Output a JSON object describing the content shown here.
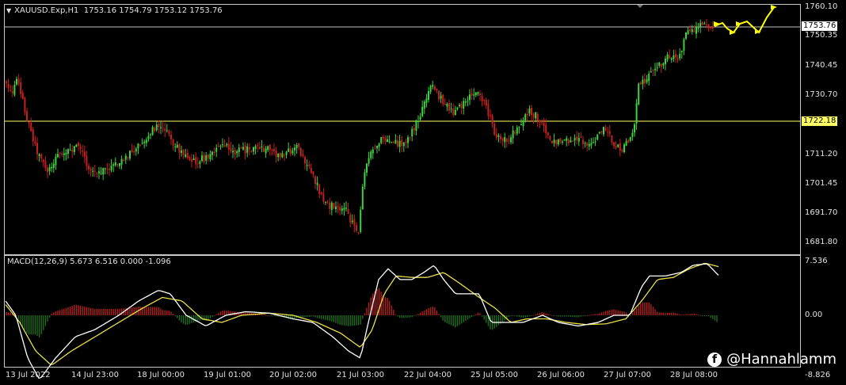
{
  "main_panel": {
    "symbol_label": "XAUUSD.Exp,H1",
    "ohlc": "1753.16 1754.79 1753.12 1753.76",
    "price_axis": [
      "1760.10",
      "1750.35",
      "1740.45",
      "1730.70",
      "1711.20",
      "1701.45",
      "1691.70",
      "1681.80"
    ],
    "current_price": "1753.76",
    "hline_price": "1722.18"
  },
  "macd_panel": {
    "label": "MACD(12,26,9) 5.673 6.516 0.000 -1.096",
    "axis": [
      "7.536",
      "0.00",
      "-8.826"
    ]
  },
  "time_axis": [
    "13 Jul 2022",
    "14 Jul 23:00",
    "18 Jul 00:00",
    "19 Jul 01:00",
    "20 Jul 02:00",
    "21 Jul 03:00",
    "22 Jul 04:00",
    "25 Jul 05:00",
    "26 Jul 06:00",
    "27 Jul 07:00",
    "28 Jul 08:00"
  ],
  "watermark": "@Hannahlamm",
  "colors": {
    "bull": "#3cd33c",
    "bear": "#c81e1e",
    "macd": "#ffffff",
    "signal": "#e8e04a",
    "hist_pos": "#b02020",
    "hist_neg": "#1f6b1f",
    "projection": "#ffff00"
  },
  "icons": {
    "menu": "triangle-down-icon",
    "social": "facebook-icon"
  }
}
